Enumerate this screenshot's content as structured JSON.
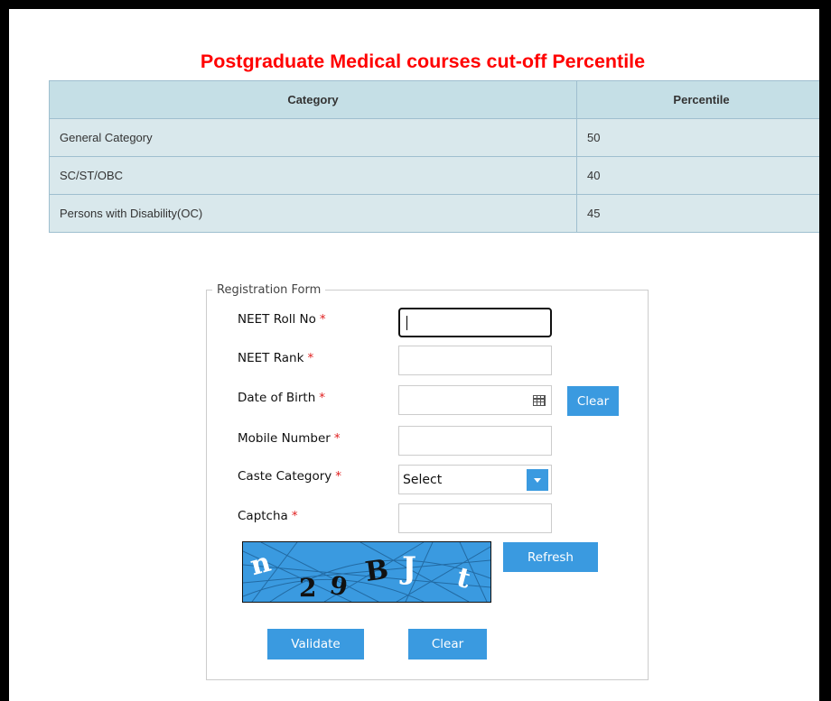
{
  "title": "Postgraduate Medical courses cut-off Percentile",
  "table": {
    "headers": [
      "Category",
      "Percentile"
    ],
    "rows": [
      [
        "General Category",
        "50"
      ],
      [
        "SC/ST/OBC",
        "40"
      ],
      [
        "Persons with Disability(OC)",
        "45"
      ]
    ]
  },
  "form": {
    "legend": "Registration Form",
    "required_mark": "*",
    "fields": {
      "roll_no": {
        "label": "NEET Roll No",
        "value": ""
      },
      "rank": {
        "label": "NEET Rank",
        "value": ""
      },
      "dob": {
        "label": "Date of Birth",
        "value": ""
      },
      "mobile": {
        "label": "Mobile Number",
        "value": ""
      },
      "caste": {
        "label": "Caste Category",
        "selected": "Select"
      },
      "captcha": {
        "label": "Captcha",
        "value": ""
      }
    },
    "dob_clear_label": "Clear",
    "captcha_text": [
      "n",
      "2",
      "9",
      "B",
      "J",
      "t"
    ],
    "refresh_label": "Refresh",
    "validate_label": "Validate",
    "clear_label": "Clear"
  },
  "colors": {
    "title": "#ff0000",
    "button": "#3a9ae0",
    "captcha_bg": "#3a9ae0"
  },
  "icons": {
    "dob": "calendar-icon",
    "caste": "chevron-down-icon"
  }
}
